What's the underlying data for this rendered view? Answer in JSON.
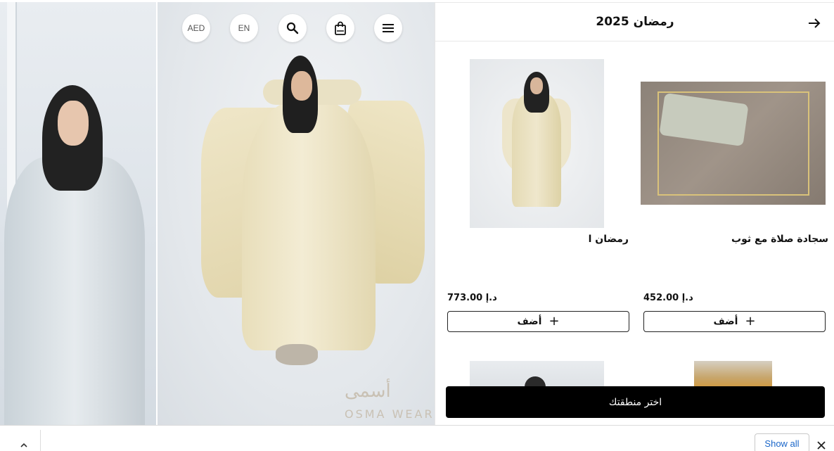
{
  "topbar": {
    "currency_label": "AED",
    "language_label": "EN",
    "icons": [
      "search-icon",
      "shopping-bag-icon",
      "menu-icon"
    ]
  },
  "hero": {
    "brand_logo": "أسمى",
    "brand_sub": "OSMA WEAR"
  },
  "panel": {
    "title": "رمضان 2025",
    "back_icon": "arrow-right-icon",
    "products": [
      {
        "name": "سجادة صلاة مع ثوب",
        "price": "452.00 د.إ",
        "add_label": "أضف"
      },
      {
        "name": "رمضان ا",
        "price": "773.00 د.إ",
        "add_label": "أضف"
      }
    ],
    "region_button": "اختر منطقتك"
  },
  "download_bar": {
    "show_all_label": "Show all",
    "chevron_icon": "chevron-up-icon",
    "close_icon": "close-icon"
  },
  "colors": {
    "region_button_bg": "#000000",
    "show_all_text": "#1a66c9"
  }
}
